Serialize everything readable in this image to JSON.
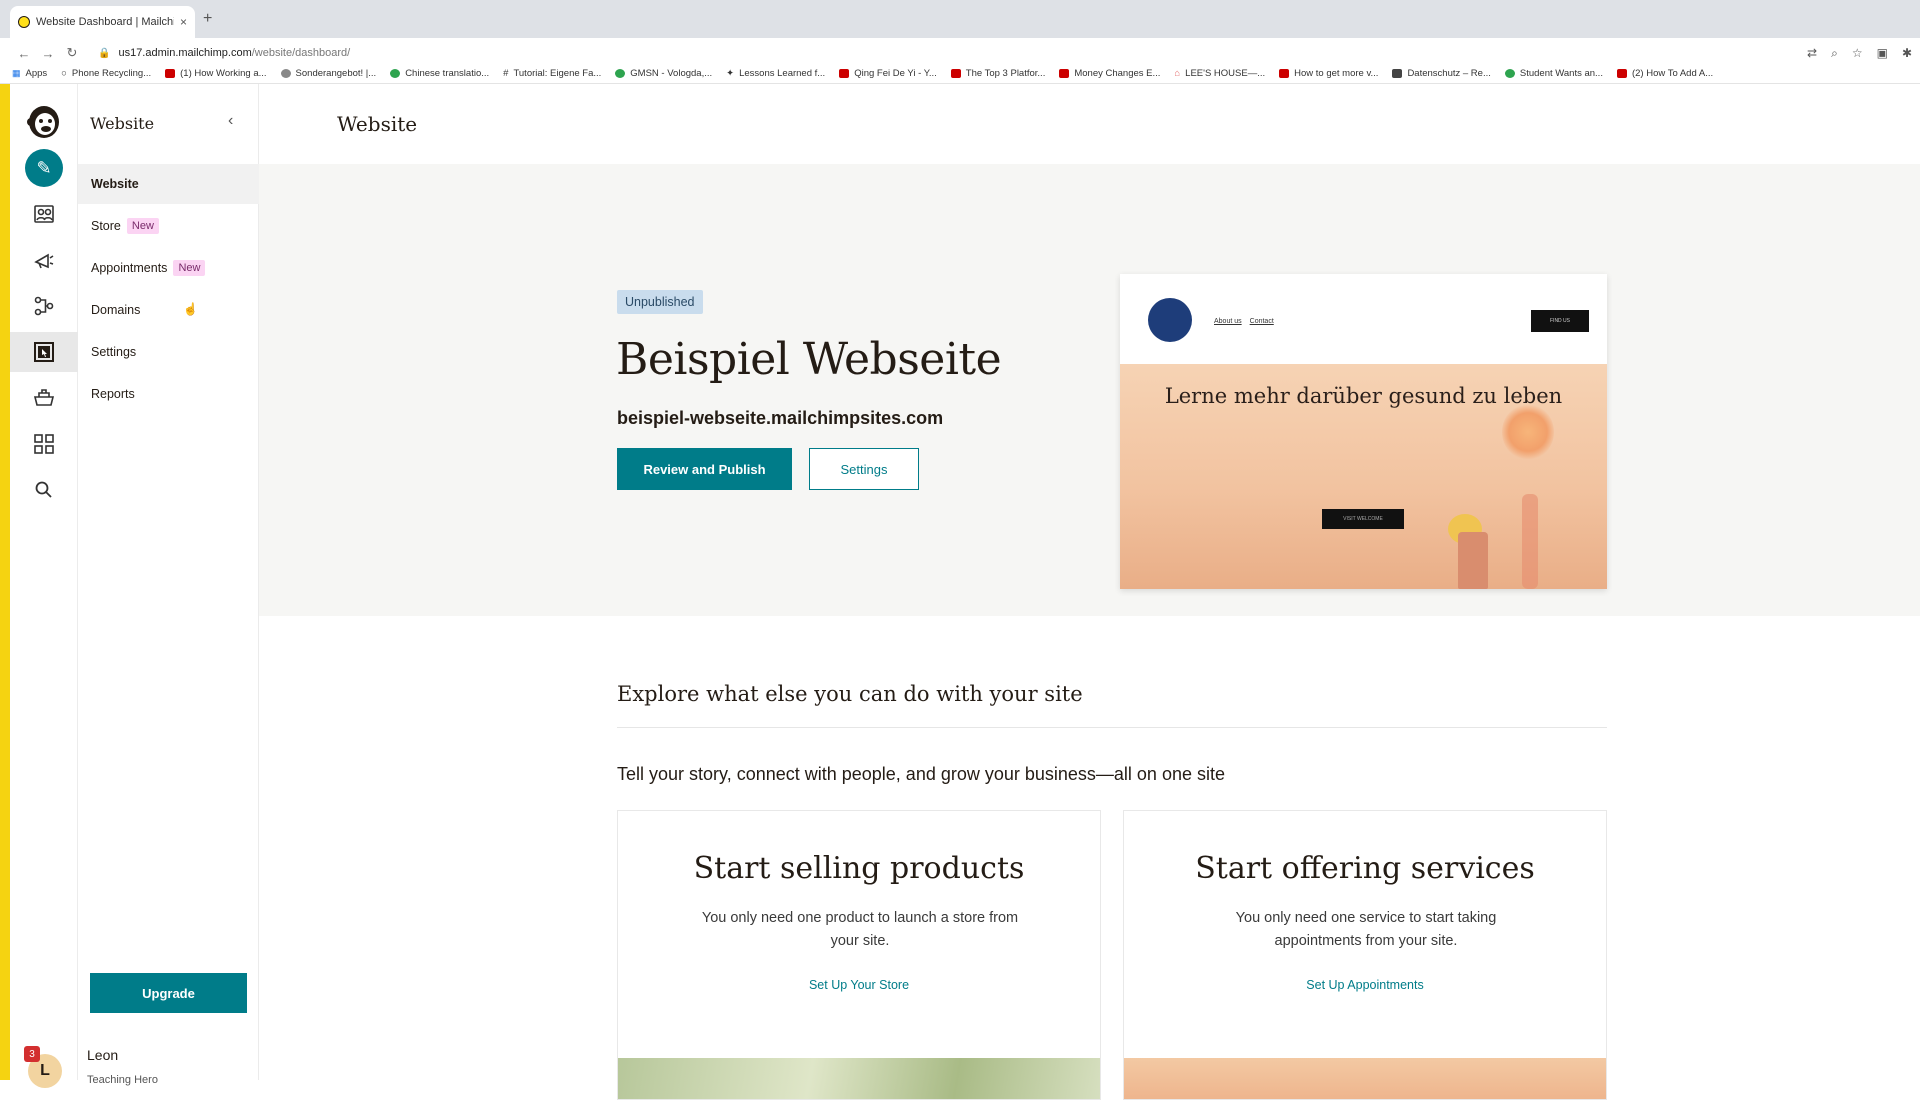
{
  "browser": {
    "tab_title": "Website Dashboard | Mailchim",
    "tab_close": "×",
    "new_tab": "+",
    "url_domain": "us17.admin.mailchimp.com",
    "url_path": "/website/dashboard/",
    "bookmarks": [
      {
        "label": "Apps",
        "icon": "apps-grid"
      },
      {
        "label": "Phone Recycling...",
        "icon": "search"
      },
      {
        "label": "(1) How Working a...",
        "icon": "youtube"
      },
      {
        "label": "Sonderangebot! |...",
        "icon": "generic"
      },
      {
        "label": "Chinese translatio...",
        "icon": "green-circle"
      },
      {
        "label": "Tutorial: Eigene Fa...",
        "icon": "hash"
      },
      {
        "label": "GMSN - Vologda,...",
        "icon": "green-circle"
      },
      {
        "label": "Lessons Learned f...",
        "icon": "generic"
      },
      {
        "label": "Qing Fei De Yi - Y...",
        "icon": "youtube"
      },
      {
        "label": "The Top 3 Platfor...",
        "icon": "youtube"
      },
      {
        "label": "Money Changes E...",
        "icon": "youtube"
      },
      {
        "label": "LEE'S HOUSE—...",
        "icon": "generic"
      },
      {
        "label": "How to get more v...",
        "icon": "youtube"
      },
      {
        "label": "Datenschutz – Re...",
        "icon": "dark"
      },
      {
        "label": "Student Wants an...",
        "icon": "green-circle"
      },
      {
        "label": "(2) How To Add A...",
        "icon": "youtube"
      }
    ]
  },
  "sidebar": {
    "title": "Website",
    "items": [
      {
        "label": "Website",
        "badge": ""
      },
      {
        "label": "Store",
        "badge": "New"
      },
      {
        "label": "Appointments",
        "badge": "New"
      },
      {
        "label": "Domains",
        "badge": ""
      },
      {
        "label": "Settings",
        "badge": ""
      },
      {
        "label": "Reports",
        "badge": ""
      }
    ],
    "upgrade_label": "Upgrade",
    "user_name": "Leon",
    "user_subtitle": "Teaching Hero",
    "user_initial": "L",
    "notification_count": "3"
  },
  "main": {
    "page_title": "Website",
    "status": "Unpublished",
    "site_name": "Beispiel Webseite",
    "site_url": "beispiel-webseite.mailchimpsites.com",
    "review_button": "Review and Publish",
    "settings_button": "Settings",
    "preview": {
      "links": [
        "About us",
        "Contact"
      ],
      "header_button": "FIND US",
      "headline": "Lerne mehr darüber gesund zu leben",
      "cta": "VISIT WELCOME"
    },
    "explore_title": "Explore what else you can do with your site",
    "explore_subtitle": "Tell your story, connect with people, and grow your business—all on one site",
    "cards": [
      {
        "title": "Start selling products",
        "description": "You only need one product to launch a store from your site.",
        "link": "Set Up Your Store"
      },
      {
        "title": "Start offering services",
        "description": "You only need one service to start taking appointments from your site.",
        "link": "Set Up Appointments"
      }
    ]
  },
  "colors": {
    "accent": "#007c89",
    "brand_yellow": "#f5d311",
    "new_badge": "#fbd4f3",
    "status_badge": "#c9dced"
  }
}
